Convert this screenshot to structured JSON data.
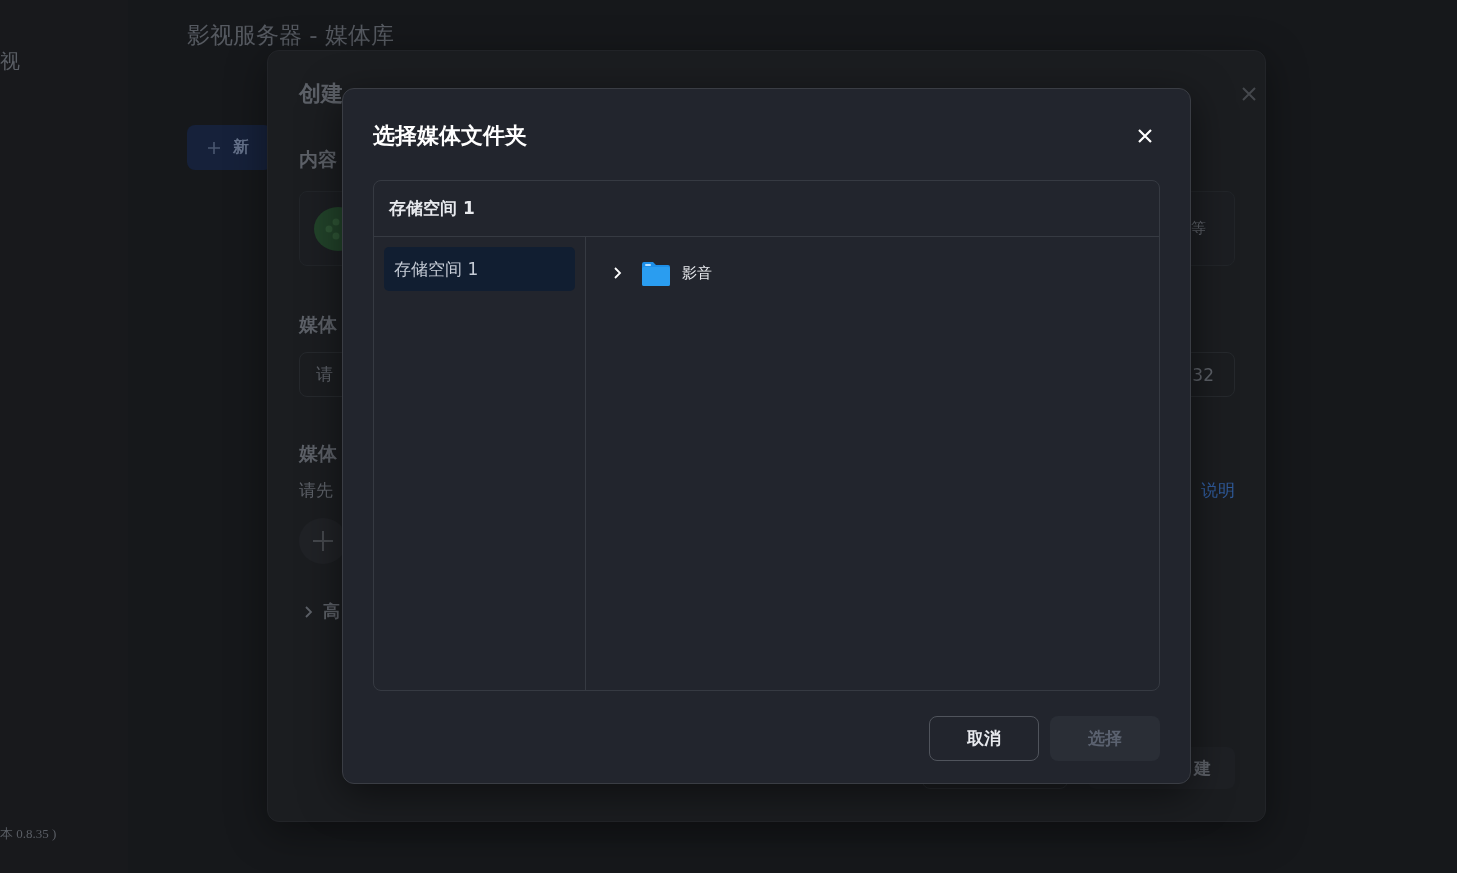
{
  "background": {
    "sidebar_text": "视",
    "version_text": "本 0.8.35 )",
    "page_title": "影视服务器 - 媒体库",
    "add_button": "新"
  },
  "library_dialog": {
    "title": "创建",
    "section_label": "内容",
    "card_text": "等",
    "name_label": "媒体",
    "name_placeholder": "请",
    "name_counter": "32",
    "folder_label": "媒体",
    "folder_hint": "请先",
    "help_link": "说明",
    "advanced": {
      "label": "高",
      "expanded": false
    },
    "confirm_button": "建"
  },
  "folder_dialog": {
    "title": "选择媒体文件夹",
    "breadcrumb": "存储空间 1",
    "volumes": [
      {
        "label": "存储空间 1",
        "selected": true
      }
    ],
    "folders": [
      {
        "name": "影音",
        "expanded": false
      }
    ],
    "buttons": [
      {
        "label": "取消",
        "kind": "secondary",
        "disabled": false
      },
      {
        "label": "选择",
        "kind": "primary",
        "disabled": true
      }
    ]
  }
}
